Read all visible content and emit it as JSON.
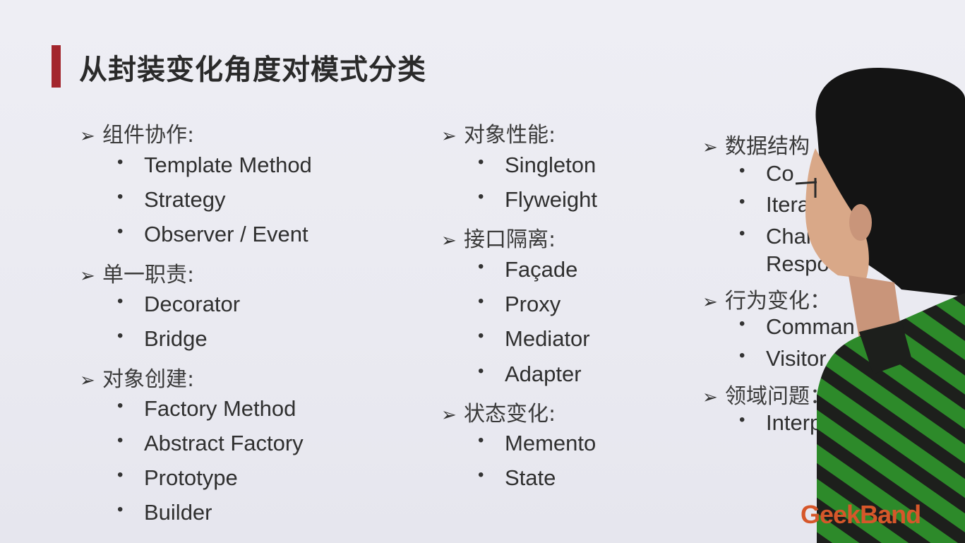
{
  "slide": {
    "title": "从封装变化角度对模式分类",
    "accent_color": "#a3262d",
    "arrow_icon": "arrowhead-bullet",
    "logo": "GeekBand"
  },
  "columns": [
    {
      "groups": [
        {
          "heading": "组件协作:",
          "items": [
            "Template Method",
            "Strategy",
            "Observer / Event"
          ]
        },
        {
          "heading": "单一职责:",
          "items": [
            "Decorator",
            "Bridge"
          ]
        },
        {
          "heading": "对象创建:",
          "items": [
            "Factory Method",
            "Abstract Factory",
            "Prototype",
            "Builder"
          ]
        }
      ]
    },
    {
      "groups": [
        {
          "heading": "对象性能:",
          "items": [
            "Singleton",
            "Flyweight"
          ]
        },
        {
          "heading": "接口隔离:",
          "items": [
            "Façade",
            "Proxy",
            "Mediator",
            "Adapter"
          ]
        },
        {
          "heading": "状态变化:",
          "items": [
            "Memento",
            "State"
          ]
        }
      ]
    },
    {
      "groups": [
        {
          "heading": "数据结构",
          "items": [
            "Co",
            "Itera",
            "Chai",
            "Respo"
          ]
        },
        {
          "heading": "行为变化：",
          "items": [
            "Comman",
            "Visitor"
          ]
        },
        {
          "heading": "领域问题：",
          "items": [
            "Interp"
          ]
        }
      ]
    }
  ]
}
